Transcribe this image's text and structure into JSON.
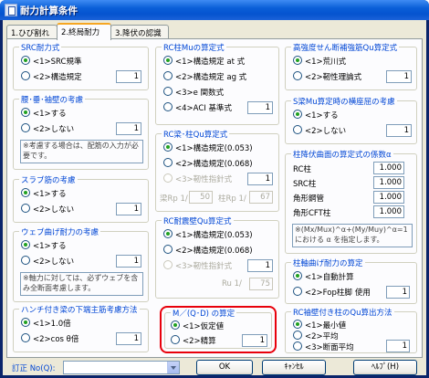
{
  "window": {
    "title": "耐力計算条件"
  },
  "tabs": [
    {
      "label": "1.ひび割れ"
    },
    {
      "label": "2.終局耐力"
    },
    {
      "label": "3.降伏の認識"
    }
  ],
  "src_bending": {
    "title": "SRC耐力式",
    "opt1": "<1>SRC規準",
    "opt2": "<2>構造規定",
    "value": "1"
  },
  "waist_hoop": {
    "title": "腰･垂･袖壁の考慮",
    "opt1": "<1>する",
    "opt2": "<2>しない",
    "value": "1",
    "note": "※考慮する場合は、配筋の入力が必要です。"
  },
  "slab": {
    "title": "スラブ筋の考慮",
    "opt1": "<1>する",
    "opt2": "<2>しない",
    "value": "1"
  },
  "web_bend": {
    "title": "ウェブ曲げ耐力の考慮",
    "opt1": "<1>する",
    "opt2": "<2>しない",
    "value": "1",
    "note": "※軸力に対しては、必ずウェブを含み全断面考慮します。"
  },
  "haunch": {
    "title": "ハンチ付き梁の下端主筋考慮方法",
    "opt1": "<1>1.0倍",
    "opt2": "<2>cos θ倍",
    "value": "1"
  },
  "rc_mu": {
    "title": "RC柱Muの算定式",
    "opt1": "<1>構造規定 at 式",
    "opt2": "<2>構造規定 ag 式",
    "opt3": "<3>e 関数式",
    "opt4": "<4>ACI 基準式",
    "value": "1"
  },
  "rc_qu": {
    "title": "RC梁･柱Qu算定式",
    "opt1": "<1>構造規定(0.053)",
    "opt2": "<2>構造規定(0.068)",
    "opt3": "<3>靭性指針式",
    "value": "1",
    "rp_beam_label": "梁Rp 1/",
    "rp_beam_value": "50",
    "rp_col_label": "柱Rp 1/",
    "rp_col_value": "67"
  },
  "rc_wall": {
    "title": "RC耐震壁Qu算定式",
    "opt1": "<1>構造規定(0.053)",
    "opt2": "<2>構造規定(0.068)",
    "opt3": "<3>靭性指針式",
    "value": "1",
    "ru_label": "Ru 1/",
    "ru_value": "75"
  },
  "mqd": {
    "title": "M／(Q･D) の算定",
    "opt1": "<1>仮定値",
    "opt2": "<2>精算",
    "value": "1"
  },
  "high_strength": {
    "title": "高強度せん断補強筋Qu算定式",
    "opt1": "<1>荒川式",
    "opt2": "<2>靭性理論式",
    "value": "1"
  },
  "s_beam": {
    "title": "S梁Mu算定時の横座屈の考慮",
    "opt1": "<1>する",
    "opt2": "<2>しない",
    "value": "1"
  },
  "col_coef": {
    "title": "柱降伏曲面の算定式の係数α",
    "items": [
      {
        "label": "RC柱",
        "value": "1.000"
      },
      {
        "label": "SRC柱",
        "value": "1.000"
      },
      {
        "label": "角形鋼管",
        "value": "1.000"
      },
      {
        "label": "角形CFT柱",
        "value": "1.000"
      }
    ],
    "note": "※(Mx/Mux)^α+(My/Muy)^α=1 における α を指定します。"
  },
  "col_bend": {
    "title": "柱軸曲げ耐力の算定",
    "opt1": "<1>自動計算",
    "opt2": "<2>Fop柱脚",
    "opt2b": "使用",
    "value": "1"
  },
  "rc_side": {
    "title": "RC袖壁付き柱のQu算出方法",
    "opt1": "<1>最小値",
    "opt2": "<2>平均",
    "opt3": "<3>断面平均",
    "value": "1"
  },
  "footer": {
    "revision_label": "訂正 No(Q):",
    "revision_value": "",
    "ok": "OK",
    "cancel": "ｷｬﾝｾﾙ",
    "help": "ﾍﾙﾌﾟ(H)"
  }
}
